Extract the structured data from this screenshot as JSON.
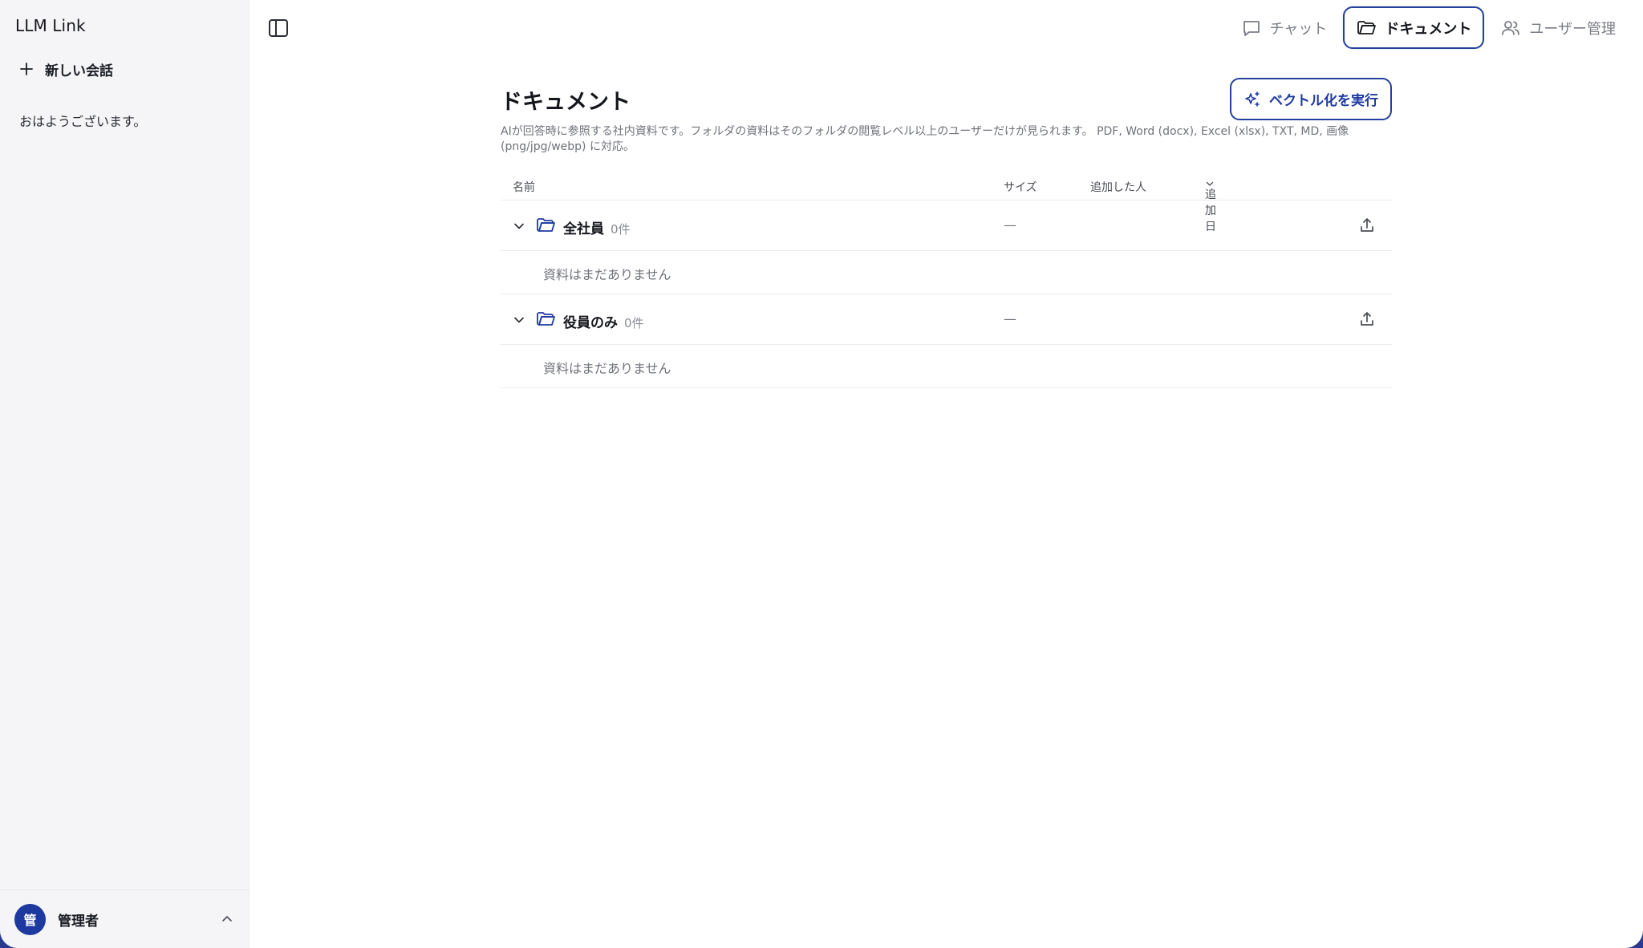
{
  "app": {
    "title": "LLM Link"
  },
  "sidebar": {
    "new_chat_label": "新しい会話",
    "greeting": "おはようございます。",
    "user": {
      "avatar_initial": "管",
      "name": "管理者"
    }
  },
  "nav": {
    "items": [
      {
        "label": "チャット",
        "icon": "chat-bubble-icon",
        "active": false
      },
      {
        "label": "ドキュメント",
        "icon": "folder-open-icon",
        "active": true
      },
      {
        "label": "ユーザー管理",
        "icon": "users-icon",
        "active": false
      }
    ]
  },
  "page": {
    "title": "ドキュメント",
    "vectorize_button": "ベクトル化を実行",
    "description": "AIが回答時に参照する社内資料です。フォルダの資料はそのフォルダの閲覧レベル以上のユーザーだけが見られます。 PDF, Word (docx), Excel (xlsx), TXT, MD, 画像 (png/jpg/webp) に対応。"
  },
  "table": {
    "columns": {
      "name": "名前",
      "size": "サイズ",
      "added_by": "追加した人",
      "added_date": "追加日"
    },
    "folders": [
      {
        "name": "全社員",
        "count": "0件",
        "size": "—",
        "empty_text": "資料はまだありません"
      },
      {
        "name": "役員のみ",
        "count": "0件",
        "size": "—",
        "empty_text": "資料はまだありません"
      }
    ]
  },
  "colors": {
    "accent": "#1e3aa0",
    "sidebar_bg": "#f5f5f7",
    "muted_text": "#6f727a"
  }
}
